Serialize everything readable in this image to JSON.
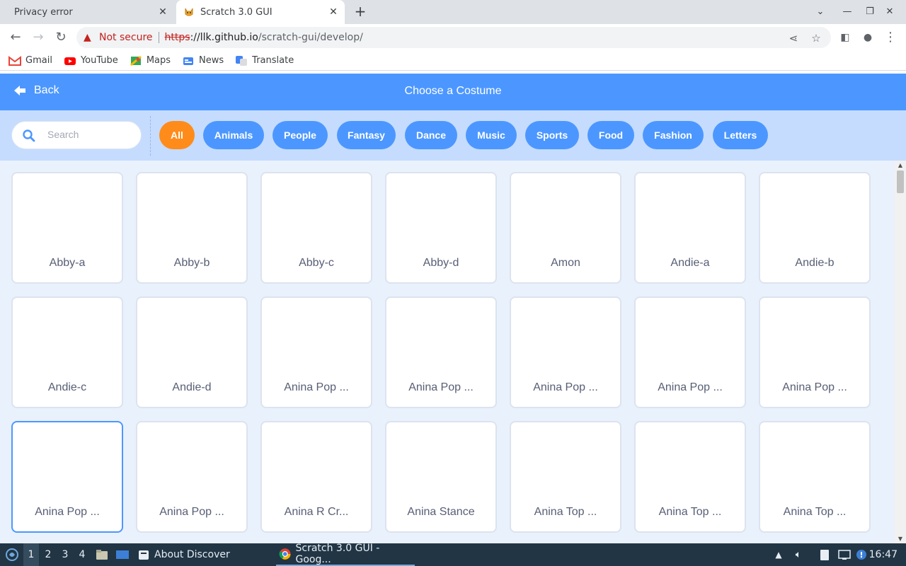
{
  "browser": {
    "tabs": [
      {
        "title": "Privacy error",
        "active": false
      },
      {
        "title": "Scratch 3.0 GUI",
        "active": true
      }
    ],
    "omnibox": {
      "security_label": "Not secure",
      "scheme": "https",
      "host": "://llk.github.io",
      "path": "/scratch-gui/develop/"
    },
    "bookmarks": [
      {
        "label": "Gmail",
        "icon": "gmail-icon"
      },
      {
        "label": "YouTube",
        "icon": "youtube-icon"
      },
      {
        "label": "Maps",
        "icon": "maps-icon"
      },
      {
        "label": "News",
        "icon": "news-icon"
      },
      {
        "label": "Translate",
        "icon": "translate-icon"
      }
    ]
  },
  "library": {
    "back_label": "Back",
    "title": "Choose a Costume",
    "search_placeholder": "Search",
    "tags": [
      "All",
      "Animals",
      "People",
      "Fantasy",
      "Dance",
      "Music",
      "Sports",
      "Food",
      "Fashion",
      "Letters"
    ],
    "selected_tag": "All",
    "items": [
      "Abby-a",
      "Abby-b",
      "Abby-c",
      "Abby-d",
      "Amon",
      "Andie-a",
      "Andie-b",
      "Andie-c",
      "Andie-d",
      "Anina Pop ...",
      "Anina Pop ...",
      "Anina Pop ...",
      "Anina Pop ...",
      "Anina Pop ...",
      "Anina Pop ...",
      "Anina Pop ...",
      "Anina R Cr...",
      "Anina Stance",
      "Anina Top ...",
      "Anina Top ...",
      "Anina Top ..."
    ]
  },
  "taskbar": {
    "workspaces": [
      "1",
      "2",
      "3",
      "4"
    ],
    "windows": [
      {
        "label": "About Discover",
        "active": false
      },
      {
        "label": "Scratch 3.0 GUI - Goog...",
        "active": true
      }
    ],
    "clock": "16:47"
  },
  "colors": {
    "scratch_blue": "#4c97ff",
    "selected_orange": "#ff8c1a",
    "filter_bg": "#c5dcff",
    "library_bg": "#e9f1fc"
  }
}
